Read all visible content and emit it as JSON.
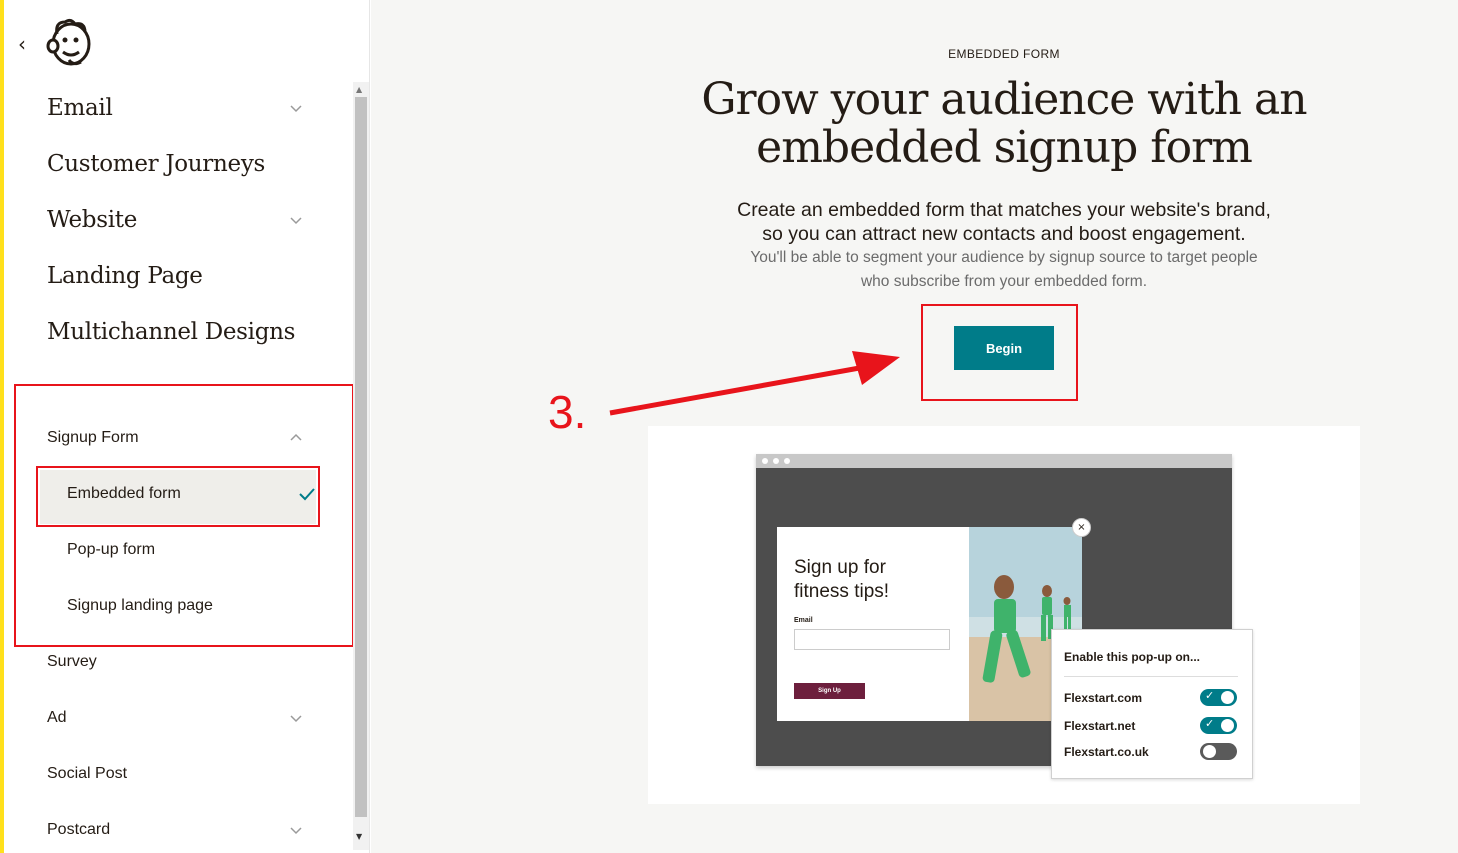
{
  "sidebar": {
    "back_glyph": "‹",
    "items": [
      {
        "label": "Email",
        "has_chevron": true
      },
      {
        "label": "Customer Journeys",
        "has_chevron": false
      },
      {
        "label": "Website",
        "has_chevron": true
      },
      {
        "label": "Landing Page",
        "has_chevron": false
      },
      {
        "label": "Multichannel Designs",
        "has_chevron": false
      }
    ],
    "signup_form": {
      "label": "Signup Form",
      "expanded": true,
      "children": [
        {
          "label": "Embedded form",
          "selected": true
        },
        {
          "label": "Pop-up form",
          "selected": false
        },
        {
          "label": "Signup landing page",
          "selected": false
        }
      ]
    },
    "lower_items": [
      {
        "label": "Survey",
        "has_chevron": false
      },
      {
        "label": "Ad",
        "has_chevron": true
      },
      {
        "label": "Social Post",
        "has_chevron": false
      },
      {
        "label": "Postcard",
        "has_chevron": true
      }
    ]
  },
  "main": {
    "eyebrow": "EMBEDDED FORM",
    "headline_line1": "Grow your audience with an",
    "headline_line2": "embedded signup form",
    "lead_line1": "Create an embedded form that matches your website's brand,",
    "lead_line2": "so you can attract new contacts and boost engagement.",
    "sub_line1": "You'll be able to segment your audience by signup source to target people",
    "sub_line2": "who subscribe from your embedded form.",
    "begin_label": "Begin"
  },
  "annotation": {
    "step_label": "3.",
    "color": "#e8141b"
  },
  "illustration": {
    "popup_title_line1": "Sign up for",
    "popup_title_line2": "fitness tips!",
    "email_label": "Email",
    "signup_button": "Sign Up",
    "close_glyph": "×",
    "enable_title": "Enable this pop-up on...",
    "sites": [
      {
        "name": "Flexstart.com",
        "enabled": true
      },
      {
        "name": "Flexstart.net",
        "enabled": true
      },
      {
        "name": "Flexstart.co.uk",
        "enabled": false
      }
    ]
  },
  "colors": {
    "accent_teal": "#007c89",
    "brand_yellow": "#ffe01b",
    "signup_button": "#6d1f3d"
  }
}
